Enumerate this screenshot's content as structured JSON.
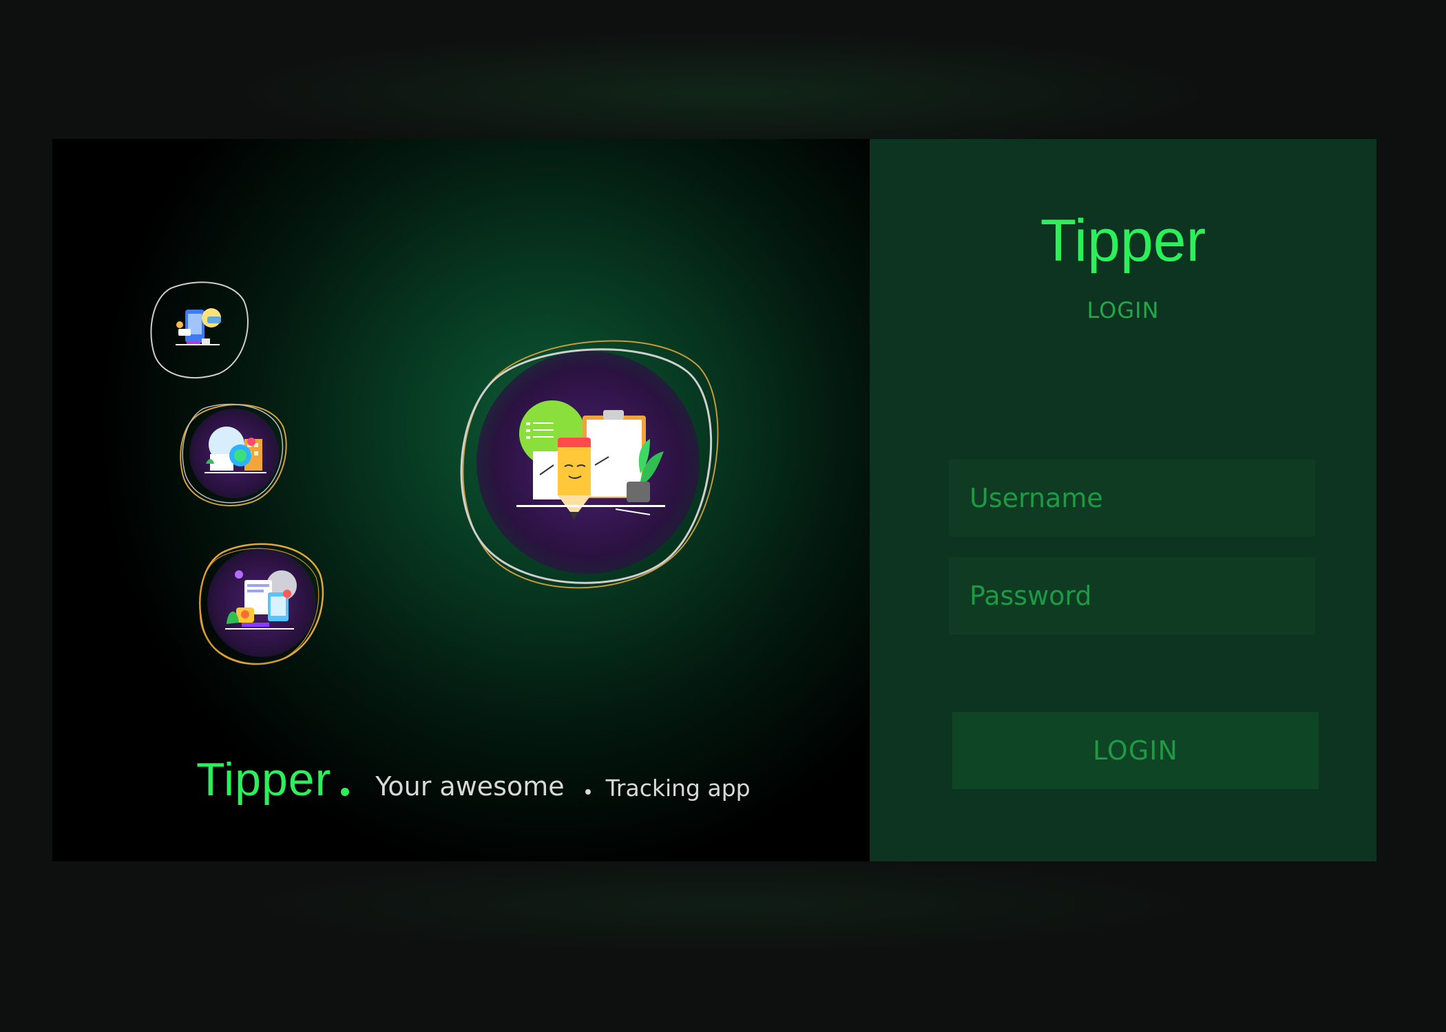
{
  "brand": {
    "name": "Tipper",
    "tagline_part1": "Your awesome",
    "tagline_part2": "Tracking app"
  },
  "login_panel": {
    "logo": "Tipper",
    "heading": "LOGIN",
    "username_placeholder": "Username",
    "password_placeholder": "Password",
    "submit_label": "LOGIN"
  },
  "illustrations": [
    "mobile-chat-illustration-icon",
    "location-map-illustration-icon",
    "devices-feedback-illustration-icon",
    "pencil-notes-illustration-icon"
  ],
  "colors": {
    "accent": "#2cf05a",
    "panel": "#0c3420",
    "field": "#0e3b22",
    "button": "#0e4525",
    "muted_green": "#22a84a"
  }
}
